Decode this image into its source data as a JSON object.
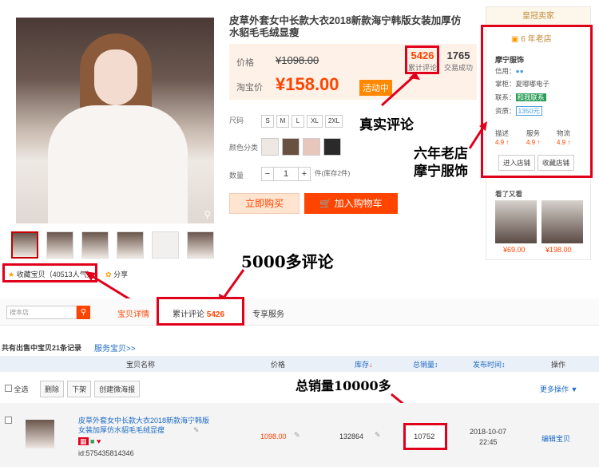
{
  "product": {
    "title": "皮草外套女中长款大衣2018新款海宁韩版女装加厚仿水貂毛毛绒显瘦",
    "price_label": "价格",
    "old_price": "¥1098.00",
    "promo_label": "淘宝价",
    "new_price": "¥158.00",
    "promo_badge": "活动中",
    "reviews_count": "5426",
    "reviews_label": "累计评论",
    "sales_count": "1765",
    "sales_label": "交易成功",
    "size_label": "尺码",
    "sizes": [
      "S",
      "M",
      "L",
      "XL",
      "2XL"
    ],
    "color_label": "颜色分类",
    "qty_label": "数量",
    "qty_minus": "−",
    "qty_value": "1",
    "qty_plus": "+",
    "stock_text": "件(库存2件)",
    "buy_now": "立即购买",
    "add_cart": "加入购物车",
    "favorite": "收藏宝贝（40513人气）",
    "share": "分享"
  },
  "seller": {
    "header": "皇冠卖家",
    "shop_age": "6 年老店",
    "shop_name": "摩宁服饰",
    "credit_label": "信用：",
    "keeper_label": "掌柜：",
    "keeper": "夏嘟嘟电子",
    "contact_label": "联系：",
    "contact": "和我联系",
    "deposit_label": "资质：",
    "deposit": "1350元",
    "desc_label": "描述",
    "desc_score": "4.9 ↑",
    "service_label": "服务",
    "service_score": "4.9 ↑",
    "logistics_label": "物流",
    "logistics_score": "4.9 ↑",
    "enter_shop": "进入店铺",
    "fav_shop": "收藏店铺",
    "also_viewed": "看了又看",
    "rec1_price": "¥69.00",
    "rec2_price": "¥198.00"
  },
  "annotations": {
    "real_reviews": "真实评论",
    "six_year": "六年老店",
    "shop_name": "摩宁服饰",
    "reviews_5000": "5000多评论",
    "sales_10000": "总销量10000多"
  },
  "tabs": {
    "search_placeholder": "搜本店",
    "search_icon": "search-icon",
    "detail": "宝贝详情",
    "reviews": "累计评论",
    "reviews_count": "5426",
    "service": "专享服务"
  },
  "listing": {
    "summary": "共有出售中宝贝21条记录",
    "service_link": "服务宝贝>>",
    "col_name": "宝贝名称",
    "col_price": "价格",
    "col_stock": "库存",
    "col_sales": "总销量",
    "col_time": "发布时间",
    "col_action": "操作",
    "select_all": "全选",
    "delete": "删除",
    "unlist": "下架",
    "create_poster": "创建微海报",
    "more_actions": "更多操作 ▼",
    "row": {
      "title": "皮草外套女中长款大衣2018新款海宁韩版女装加厚仿水貂毛毛绒显瘦",
      "item_id": "id:575435814346",
      "price": "1098.00",
      "stock": "132864",
      "sales": "10752",
      "date": "2018-10-07",
      "time": "22:45",
      "edit": "编辑宝贝"
    }
  },
  "colors": {
    "accent": "#ff4400",
    "annotation_red": "#e1001a",
    "link": "#1c6ac6"
  }
}
